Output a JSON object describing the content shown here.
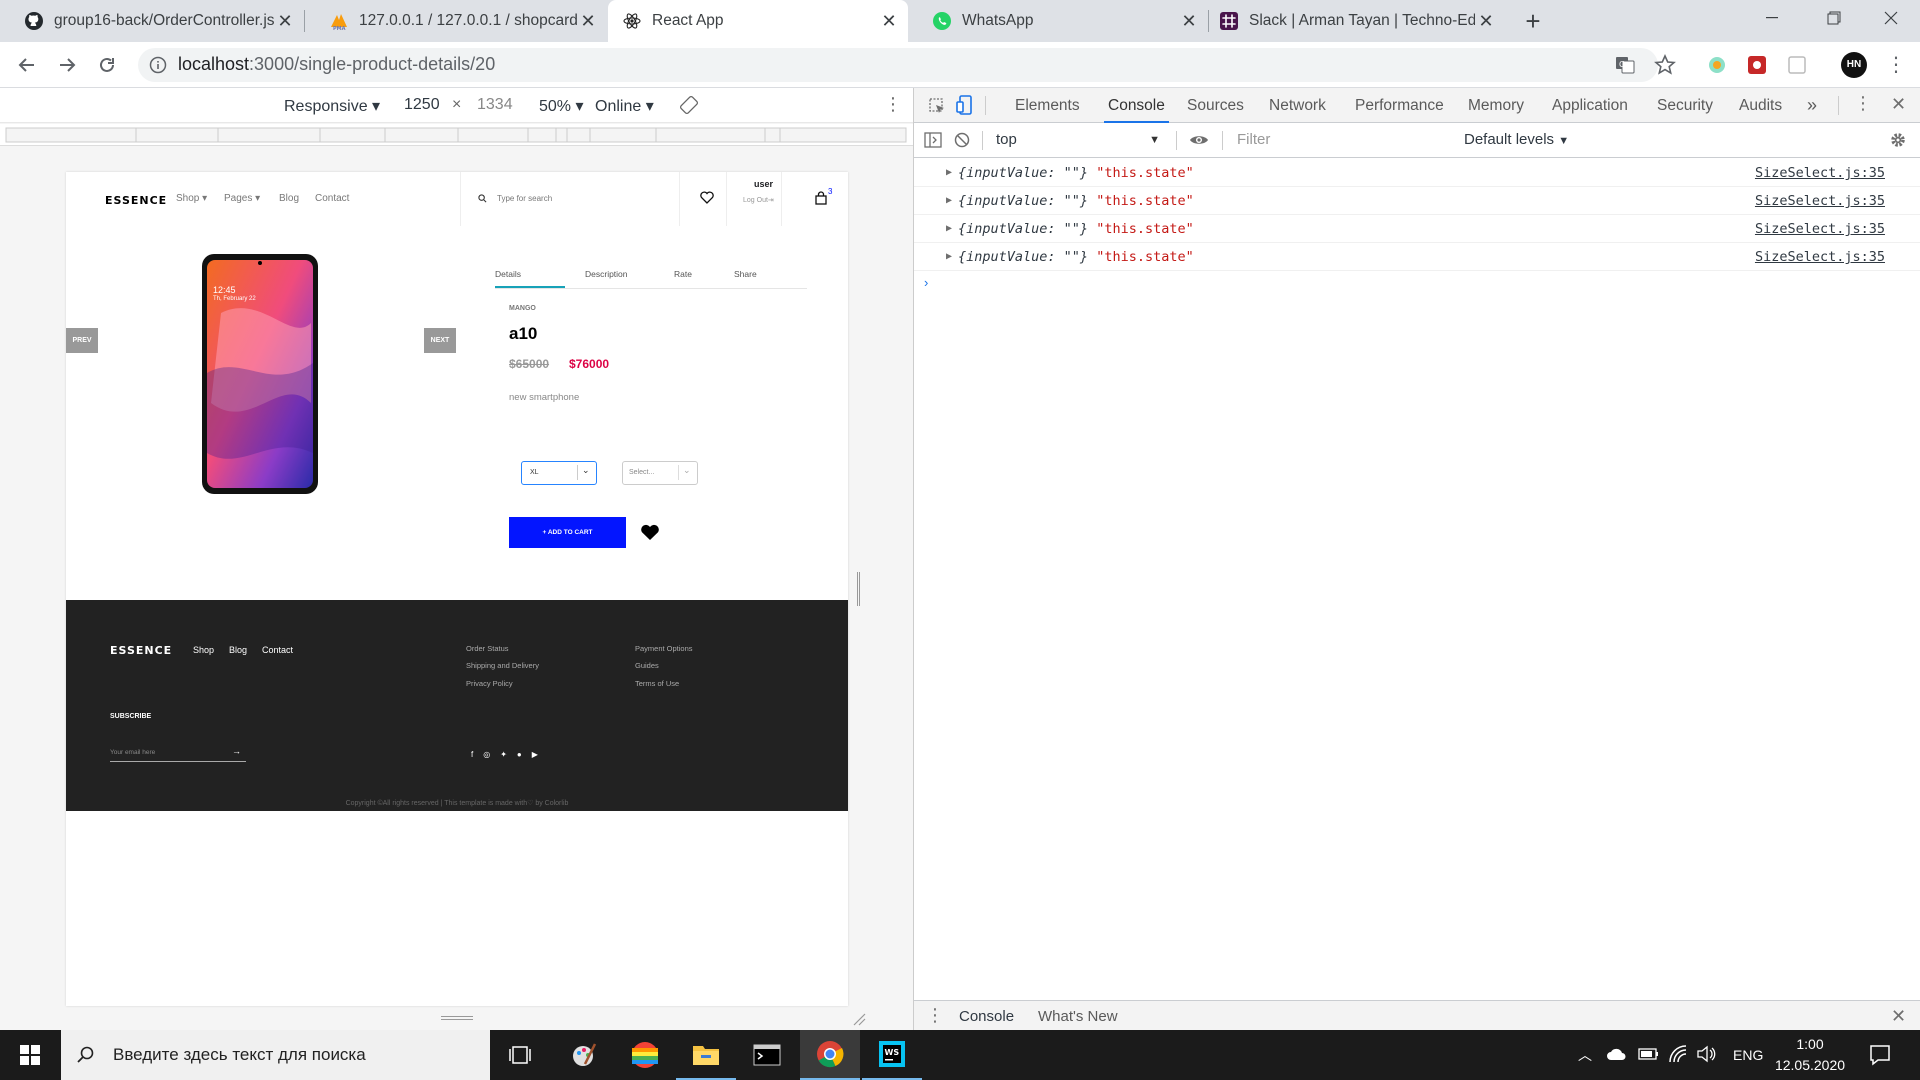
{
  "tabs": [
    {
      "title": "group16-back/OrderController.js",
      "icon": "github-icon"
    },
    {
      "title": "127.0.0.1 / 127.0.0.1 / shopcard /",
      "icon": "phpmyadmin-icon"
    },
    {
      "title": "React App",
      "icon": "react-icon",
      "active": true
    },
    {
      "title": "WhatsApp",
      "icon": "whatsapp-icon"
    },
    {
      "title": "Slack | Arman Tayan | Techno-Edu",
      "icon": "slack-icon"
    }
  ],
  "address": {
    "host": "localhost",
    "path": ":3000/single-product-details/20"
  },
  "profile_initials": "HN",
  "emulation": {
    "mode": "Responsive",
    "width": "1250",
    "height": "1334",
    "zoom": "50%",
    "network": "Online",
    "times": "×"
  },
  "site": {
    "logo": "ESSENCE",
    "nav": [
      "Shop",
      "Pages",
      "Blog",
      "Contact"
    ],
    "search_placeholder": "Type for search",
    "user_name": "user",
    "logout": "Log Out",
    "cart_count": "3",
    "prev": "PREV",
    "next": "NEXT",
    "phone_time": "12:45",
    "phone_date": "Th, February 22",
    "product_tabs": [
      "Details",
      "Description",
      "Rate",
      "Share"
    ],
    "brand": "MANGO",
    "name": "a10",
    "old_price": "$65000",
    "new_price": "$76000",
    "description": "new smartphone",
    "size_value": "XL",
    "color_value": "Select...",
    "add_to_cart": "+ ADD TO CART",
    "footer": {
      "logo": "ESSENCE",
      "links": [
        "Shop",
        "Blog",
        "Contact"
      ],
      "col1": [
        "Order Status",
        "Shipping and Delivery",
        "Privacy Policy"
      ],
      "col2": [
        "Payment Options",
        "Guides",
        "Terms of Use"
      ],
      "subscribe": "SUBSCRIBE",
      "email_placeholder": "Your email here",
      "copyright": "Copyright ©All rights reserved | This template is made with♡ by Colorlib"
    }
  },
  "devtools": {
    "tabs": [
      "Elements",
      "Console",
      "Sources",
      "Network",
      "Performance",
      "Memory",
      "Application",
      "Security",
      "Audits"
    ],
    "more": "»",
    "context": "top",
    "filter_placeholder": "Filter",
    "levels": "Default levels",
    "logs": [
      {
        "obj": "{inputValue: \"\"}",
        "str": "\"this.state\"",
        "src": "SizeSelect.js:35"
      },
      {
        "obj": "{inputValue: \"\"}",
        "str": "\"this.state\"",
        "src": "SizeSelect.js:35"
      },
      {
        "obj": "{inputValue: \"\"}",
        "str": "\"this.state\"",
        "src": "SizeSelect.js:35"
      },
      {
        "obj": "{inputValue: \"\"}",
        "str": "\"this.state\"",
        "src": "SizeSelect.js:35"
      }
    ],
    "drawer_tabs": [
      "Console",
      "What's New"
    ]
  },
  "taskbar": {
    "search_placeholder": "Введите здесь текст для поиска",
    "lang": "ENG",
    "time": "1:00",
    "date": "12.05.2020"
  },
  "colors": {
    "accent": "#1a73e8",
    "price_red": "#dc0345",
    "cart_blue": "#0315ff",
    "footer": "#222222"
  }
}
